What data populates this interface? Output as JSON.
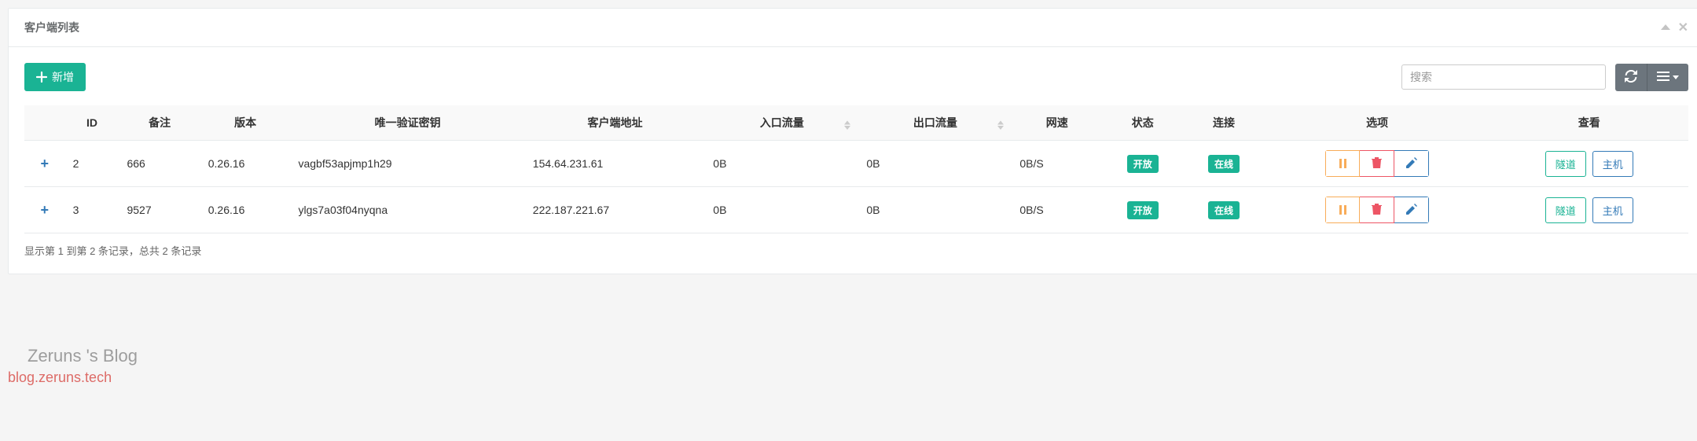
{
  "panel": {
    "title": "客户端列表"
  },
  "toolbar": {
    "add_label": "新增",
    "search_placeholder": "搜索"
  },
  "columns": {
    "id": "ID",
    "remark": "备注",
    "version": "版本",
    "key": "唯一验证密钥",
    "addr": "客户端地址",
    "in": "入口流量",
    "out": "出口流量",
    "speed": "网速",
    "status": "状态",
    "conn": "连接",
    "opts": "选项",
    "view": "查看"
  },
  "rows": [
    {
      "id": "2",
      "remark": "666",
      "version": "0.26.16",
      "key": "vagbf53apjmp1h29",
      "addr": "154.64.231.61",
      "in": "0B",
      "out": "0B",
      "speed": "0B/S",
      "status": "开放",
      "conn": "在线"
    },
    {
      "id": "3",
      "remark": "9527",
      "version": "0.26.16",
      "key": "ylgs7a03f04nyqna",
      "addr": "222.187.221.67",
      "in": "0B",
      "out": "0B",
      "speed": "0B/S",
      "status": "开放",
      "conn": "在线"
    }
  ],
  "labels": {
    "tunnel": "隧道",
    "host": "主机"
  },
  "footer": "显示第 1 到第 2 条记录，总共 2 条记录",
  "watermark": {
    "line1": "Zeruns 's Blog",
    "line2": "blog.zeruns.tech"
  }
}
